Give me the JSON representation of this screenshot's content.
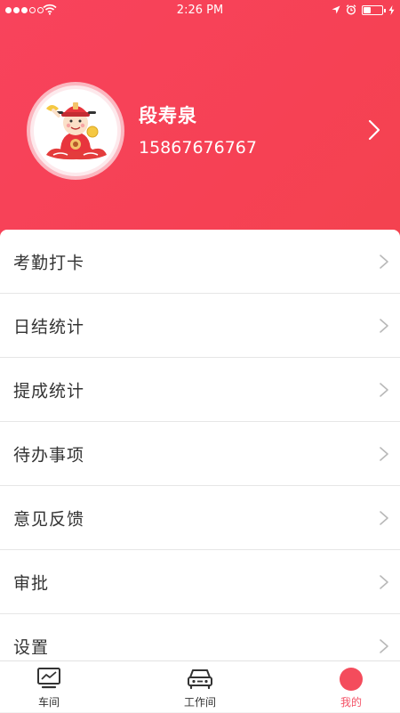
{
  "status_bar": {
    "time": "2:26 PM"
  },
  "profile": {
    "name": "段寿泉",
    "phone": "15867676767"
  },
  "menu": {
    "items": [
      {
        "label": "考勤打卡"
      },
      {
        "label": "日结统计"
      },
      {
        "label": "提成统计"
      },
      {
        "label": "待办事项"
      },
      {
        "label": "意见反馈"
      },
      {
        "label": "审批"
      },
      {
        "label": "设置"
      }
    ]
  },
  "tabbar": {
    "tabs": [
      {
        "label": "车间",
        "icon": "chart-monitor-icon",
        "active": false
      },
      {
        "label": "工作间",
        "icon": "car-icon",
        "active": false
      },
      {
        "label": "我的",
        "icon": "profile-dot-icon",
        "active": true
      }
    ]
  },
  "colors": {
    "header": "#f64155",
    "accent": "#f45266"
  }
}
